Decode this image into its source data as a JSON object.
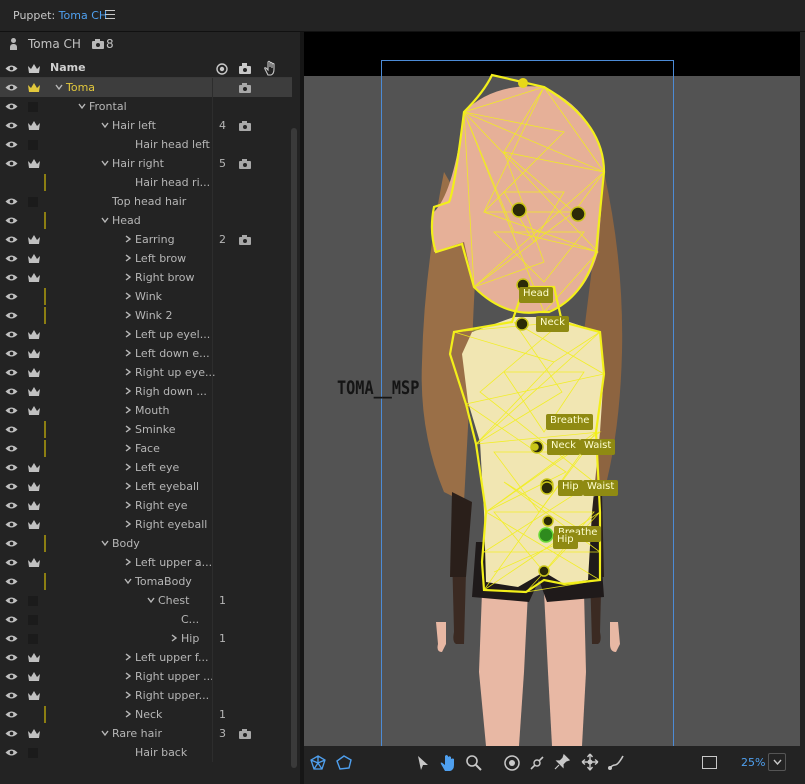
{
  "panel": {
    "title_prefix": "Puppet: ",
    "puppet_name": "Toma CH",
    "menu_icon": "hamburger-icon"
  },
  "puppet": {
    "name": "Toma CH",
    "camera_count": "8"
  },
  "columns": {
    "name": "Name",
    "icons": [
      "eye-icon",
      "crown-icon",
      "record-icon",
      "camera-icon",
      "hand-icon"
    ]
  },
  "layers": [
    {
      "label": "Toma",
      "indent": 0,
      "chev": "down",
      "eye": true,
      "crown": true,
      "selected": true,
      "count": "",
      "cam": true,
      "bar": false
    },
    {
      "label": "Frontal",
      "indent": 1,
      "chev": "down",
      "eye": true,
      "crown": false,
      "count": "",
      "cam": false,
      "bar": false
    },
    {
      "label": "Hair left",
      "indent": 2,
      "chev": "down",
      "eye": true,
      "crown": true,
      "count": "4",
      "cam": true,
      "bar": false
    },
    {
      "label": "Hair head left",
      "indent": 3,
      "chev": "",
      "eye": true,
      "crown": false,
      "count": "",
      "cam": false,
      "bar": false
    },
    {
      "label": "Hair right",
      "indent": 2,
      "chev": "down",
      "eye": true,
      "crown": true,
      "count": "5",
      "cam": true,
      "bar": false
    },
    {
      "label": "Hair head ri...",
      "indent": 3,
      "chev": "",
      "eye": false,
      "crown": false,
      "count": "",
      "cam": false,
      "bar": true
    },
    {
      "label": "Top head hair",
      "indent": 2,
      "chev": "",
      "eye": true,
      "crown": false,
      "count": "",
      "cam": false,
      "bar": false
    },
    {
      "label": "Head",
      "indent": 2,
      "chev": "down",
      "eye": true,
      "crown": false,
      "count": "",
      "cam": false,
      "bar": true
    },
    {
      "label": "Earring",
      "indent": 3,
      "chev": "right",
      "eye": true,
      "crown": true,
      "count": "2",
      "cam": true,
      "bar": false
    },
    {
      "label": "Left brow",
      "indent": 3,
      "chev": "right",
      "eye": true,
      "crown": true,
      "count": "",
      "cam": false,
      "bar": false
    },
    {
      "label": "Right brow",
      "indent": 3,
      "chev": "right",
      "eye": true,
      "crown": true,
      "count": "",
      "cam": false,
      "bar": false
    },
    {
      "label": "Wink",
      "indent": 3,
      "chev": "right",
      "eye": true,
      "crown": false,
      "count": "",
      "cam": false,
      "bar": true
    },
    {
      "label": "Wink 2",
      "indent": 3,
      "chev": "right",
      "eye": true,
      "crown": false,
      "count": "",
      "cam": false,
      "bar": true
    },
    {
      "label": "Left up eyel...",
      "indent": 3,
      "chev": "right",
      "eye": true,
      "crown": true,
      "count": "",
      "cam": false,
      "bar": false
    },
    {
      "label": "Left down e...",
      "indent": 3,
      "chev": "right",
      "eye": true,
      "crown": true,
      "count": "",
      "cam": false,
      "bar": false
    },
    {
      "label": "Right up eye...",
      "indent": 3,
      "chev": "right",
      "eye": true,
      "crown": true,
      "count": "",
      "cam": false,
      "bar": false
    },
    {
      "label": "Righ down ...",
      "indent": 3,
      "chev": "right",
      "eye": true,
      "crown": true,
      "count": "",
      "cam": false,
      "bar": false
    },
    {
      "label": "Mouth",
      "indent": 3,
      "chev": "right",
      "eye": true,
      "crown": true,
      "count": "",
      "cam": false,
      "bar": false
    },
    {
      "label": "Sminke",
      "indent": 3,
      "chev": "right",
      "eye": true,
      "crown": false,
      "count": "",
      "cam": false,
      "bar": true
    },
    {
      "label": "Face",
      "indent": 3,
      "chev": "right",
      "eye": true,
      "crown": false,
      "count": "",
      "cam": false,
      "bar": true
    },
    {
      "label": "Left eye",
      "indent": 3,
      "chev": "right",
      "eye": true,
      "crown": true,
      "count": "",
      "cam": false,
      "bar": false
    },
    {
      "label": "Left eyeball",
      "indent": 3,
      "chev": "right",
      "eye": true,
      "crown": true,
      "count": "",
      "cam": false,
      "bar": false
    },
    {
      "label": "Right eye",
      "indent": 3,
      "chev": "right",
      "eye": true,
      "crown": true,
      "count": "",
      "cam": false,
      "bar": false
    },
    {
      "label": "Right eyeball",
      "indent": 3,
      "chev": "right",
      "eye": true,
      "crown": true,
      "count": "",
      "cam": false,
      "bar": false
    },
    {
      "label": "Body",
      "indent": 2,
      "chev": "down",
      "eye": true,
      "crown": false,
      "count": "",
      "cam": false,
      "bar": true
    },
    {
      "label": "Left upper a...",
      "indent": 3,
      "chev": "right",
      "eye": true,
      "crown": true,
      "count": "",
      "cam": false,
      "bar": false
    },
    {
      "label": "TomaBody",
      "indent": 3,
      "chev": "down",
      "eye": true,
      "crown": false,
      "count": "",
      "cam": false,
      "bar": true
    },
    {
      "label": "Chest",
      "indent": 4,
      "chev": "down",
      "eye": true,
      "crown": false,
      "count": "1",
      "cam": false,
      "bar": false
    },
    {
      "label": "C...",
      "indent": 5,
      "chev": "",
      "eye": true,
      "crown": false,
      "count": "",
      "cam": false,
      "bar": false
    },
    {
      "label": "Hip",
      "indent": 5,
      "chev": "right",
      "eye": true,
      "crown": false,
      "count": "1",
      "cam": false,
      "bar": false
    },
    {
      "label": "Left upper f...",
      "indent": 3,
      "chev": "right",
      "eye": true,
      "crown": true,
      "count": "",
      "cam": false,
      "bar": false
    },
    {
      "label": "Right upper ...",
      "indent": 3,
      "chev": "right",
      "eye": true,
      "crown": true,
      "count": "",
      "cam": false,
      "bar": false
    },
    {
      "label": "Right upper...",
      "indent": 3,
      "chev": "right",
      "eye": true,
      "crown": true,
      "count": "",
      "cam": false,
      "bar": false
    },
    {
      "label": "Neck",
      "indent": 3,
      "chev": "right",
      "eye": true,
      "crown": false,
      "count": "1",
      "cam": false,
      "bar": true
    },
    {
      "label": "Rare hair",
      "indent": 2,
      "chev": "down",
      "eye": true,
      "crown": true,
      "count": "3",
      "cam": true,
      "bar": false
    },
    {
      "label": "Hair back",
      "indent": 3,
      "chev": "",
      "eye": true,
      "crown": false,
      "count": "",
      "cam": false,
      "bar": false
    }
  ],
  "viewer": {
    "watermark": "TOMA__MSP",
    "handle_tags": [
      {
        "name": "tag-head",
        "text": "Head"
      },
      {
        "name": "tag-neck",
        "text": "Neck"
      },
      {
        "name": "tag-breathe",
        "text": "Breathe"
      },
      {
        "name": "tag-neck-2",
        "text": "Neck"
      },
      {
        "name": "tag-waist",
        "text": "Waist"
      },
      {
        "name": "tag-hip",
        "text": "Hip"
      },
      {
        "name": "tag-waist-2",
        "text": "Waist"
      },
      {
        "name": "tag-breathe-2",
        "text": "Breathe"
      },
      {
        "name": "tag-hip-2",
        "text": "Hip"
      }
    ],
    "mesh_color": "#f2ef1a",
    "bounds_color": "#4c8bd6"
  },
  "toolbar": {
    "left_tools": [
      "mesh-icon",
      "shape-icon"
    ],
    "tools": [
      "select-arrow-icon",
      "hand-icon",
      "zoom-icon",
      "origin-icon",
      "stick-icon",
      "pin-icon",
      "dragger-icon",
      "bend-icon"
    ],
    "zoom": "25%",
    "zoom_dropdown": "chevron-down-icon"
  },
  "colors": {
    "accent_blue": "#4fa0ef",
    "selected_gold": "#e2c83c",
    "tag_bg": "#8f8a12"
  }
}
